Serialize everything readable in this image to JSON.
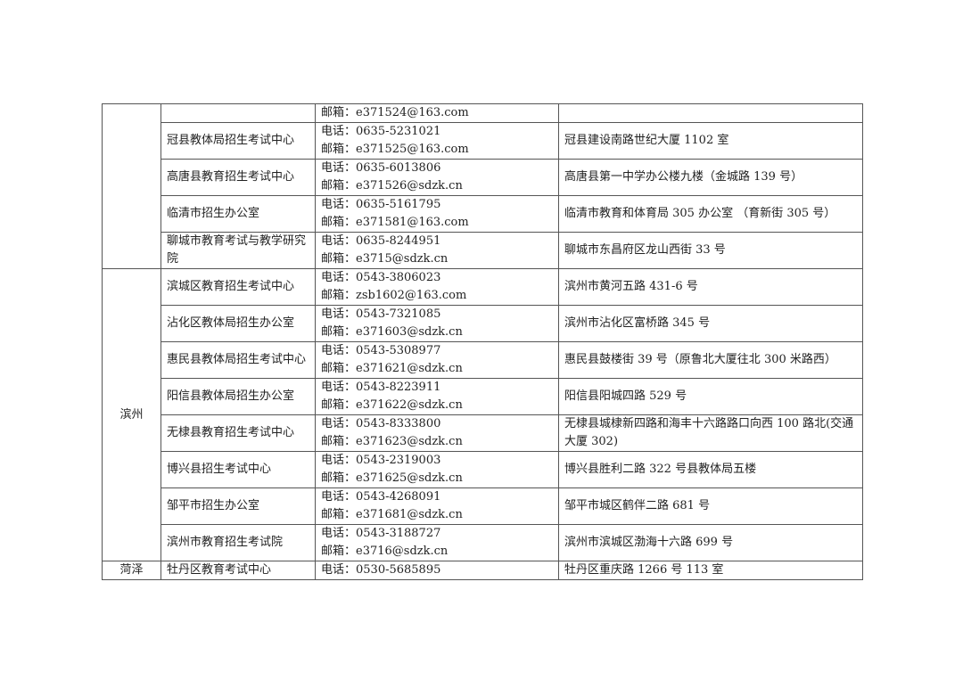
{
  "rows": [
    {
      "org": "",
      "phone": "",
      "email": "邮箱：e371524@163.com",
      "address": ""
    },
    {
      "org": "冠县教体局招生考试中心",
      "phone": "电话：0635-5231021",
      "email": "邮箱：e371525@163.com",
      "address": "冠县建设南路世纪大厦 1102 室"
    },
    {
      "org": "高唐县教育招生考试中心",
      "phone": "电话：0635-6013806",
      "email": "邮箱：e371526@sdzk.cn",
      "address": "高唐县第一中学办公楼九楼（金城路 139 号）"
    },
    {
      "org": "临清市招生办公室",
      "phone": "电话：0635-5161795",
      "email": "邮箱：e371581@163.com",
      "address": "临清市教育和体育局 305 办公室 （育新街 305 号）"
    },
    {
      "org": "聊城市教育考试与教学研究院",
      "phone": "电话：0635-8244951",
      "email": "邮箱：e3715@sdzk.cn",
      "address": "聊城市东昌府区龙山西街 33 号"
    },
    {
      "org": "滨城区教育招生考试中心",
      "phone": "电话：0543-3806023",
      "email": "邮箱：zsb1602@163.com",
      "address": "滨州市黄河五路 431-6 号"
    },
    {
      "org": "沾化区教体局招生办公室",
      "phone": "电话：0543-7321085",
      "email": "邮箱：e371603@sdzk.cn",
      "address": "滨州市沾化区富桥路 345 号"
    },
    {
      "org": "惠民县教体局招生考试中心",
      "phone": "电话：0543-5308977",
      "email": "邮箱：e371621@sdzk.cn",
      "address": "惠民县鼓楼街 39 号（原鲁北大厦往北 300 米路西）"
    },
    {
      "org": "阳信县教体局招生办公室",
      "phone": "电话：0543-8223911",
      "email": "邮箱：e371622@sdzk.cn",
      "address": "阳信县阳城四路 529 号"
    },
    {
      "org": "无棣县教育招生考试中心",
      "phone": "电话：0543-8333800",
      "email": "邮箱：e371623@sdzk.cn",
      "address": "无棣县城棣新四路和海丰十六路路口向西 100 路北(交通大厦 302)"
    },
    {
      "org": "博兴县招生考试中心",
      "phone": "电话：0543-2319003",
      "email": "邮箱：e371625@sdzk.cn",
      "address": "博兴县胜利二路 322 号县教体局五楼"
    },
    {
      "org": "邹平市招生办公室",
      "phone": "电话：0543-4268091",
      "email": "邮箱：e371681@sdzk.cn",
      "address": "邹平市城区鹤伴二路 681 号"
    },
    {
      "org": "滨州市教育招生考试院",
      "phone": "电话：0543-3188727",
      "email": "邮箱：e3716@sdzk.cn",
      "address": "滨州市滨城区渤海十六路 699 号"
    },
    {
      "org": "牡丹区教育考试中心",
      "phone": "电话：0530-5685895",
      "email": "",
      "address": "牡丹区重庆路 1266 号 113 室"
    }
  ],
  "cities": {
    "liaocheng": "",
    "binzhou": "滨州",
    "heze": "菏泽"
  }
}
